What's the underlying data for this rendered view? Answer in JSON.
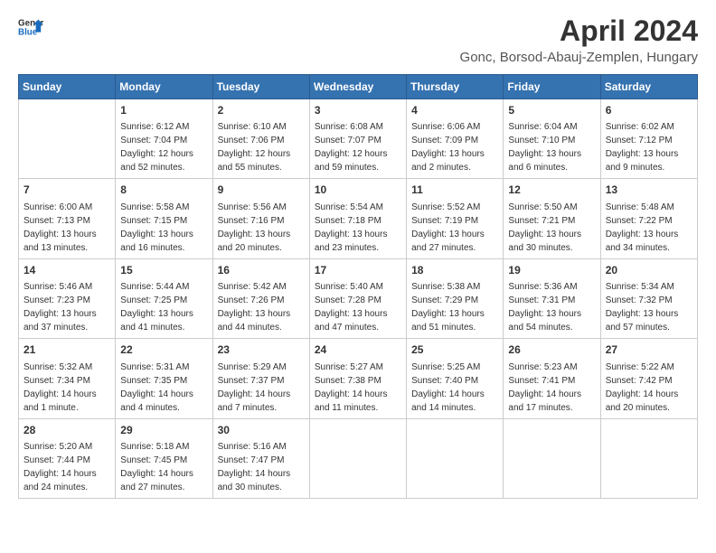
{
  "header": {
    "logo_general": "General",
    "logo_blue": "Blue",
    "month": "April 2024",
    "location": "Gonc, Borsod-Abauj-Zemplen, Hungary"
  },
  "weekdays": [
    "Sunday",
    "Monday",
    "Tuesday",
    "Wednesday",
    "Thursday",
    "Friday",
    "Saturday"
  ],
  "weeks": [
    [
      {
        "day": "",
        "info": ""
      },
      {
        "day": "1",
        "info": "Sunrise: 6:12 AM\nSunset: 7:04 PM\nDaylight: 12 hours\nand 52 minutes."
      },
      {
        "day": "2",
        "info": "Sunrise: 6:10 AM\nSunset: 7:06 PM\nDaylight: 12 hours\nand 55 minutes."
      },
      {
        "day": "3",
        "info": "Sunrise: 6:08 AM\nSunset: 7:07 PM\nDaylight: 12 hours\nand 59 minutes."
      },
      {
        "day": "4",
        "info": "Sunrise: 6:06 AM\nSunset: 7:09 PM\nDaylight: 13 hours\nand 2 minutes."
      },
      {
        "day": "5",
        "info": "Sunrise: 6:04 AM\nSunset: 7:10 PM\nDaylight: 13 hours\nand 6 minutes."
      },
      {
        "day": "6",
        "info": "Sunrise: 6:02 AM\nSunset: 7:12 PM\nDaylight: 13 hours\nand 9 minutes."
      }
    ],
    [
      {
        "day": "7",
        "info": "Sunrise: 6:00 AM\nSunset: 7:13 PM\nDaylight: 13 hours\nand 13 minutes."
      },
      {
        "day": "8",
        "info": "Sunrise: 5:58 AM\nSunset: 7:15 PM\nDaylight: 13 hours\nand 16 minutes."
      },
      {
        "day": "9",
        "info": "Sunrise: 5:56 AM\nSunset: 7:16 PM\nDaylight: 13 hours\nand 20 minutes."
      },
      {
        "day": "10",
        "info": "Sunrise: 5:54 AM\nSunset: 7:18 PM\nDaylight: 13 hours\nand 23 minutes."
      },
      {
        "day": "11",
        "info": "Sunrise: 5:52 AM\nSunset: 7:19 PM\nDaylight: 13 hours\nand 27 minutes."
      },
      {
        "day": "12",
        "info": "Sunrise: 5:50 AM\nSunset: 7:21 PM\nDaylight: 13 hours\nand 30 minutes."
      },
      {
        "day": "13",
        "info": "Sunrise: 5:48 AM\nSunset: 7:22 PM\nDaylight: 13 hours\nand 34 minutes."
      }
    ],
    [
      {
        "day": "14",
        "info": "Sunrise: 5:46 AM\nSunset: 7:23 PM\nDaylight: 13 hours\nand 37 minutes."
      },
      {
        "day": "15",
        "info": "Sunrise: 5:44 AM\nSunset: 7:25 PM\nDaylight: 13 hours\nand 41 minutes."
      },
      {
        "day": "16",
        "info": "Sunrise: 5:42 AM\nSunset: 7:26 PM\nDaylight: 13 hours\nand 44 minutes."
      },
      {
        "day": "17",
        "info": "Sunrise: 5:40 AM\nSunset: 7:28 PM\nDaylight: 13 hours\nand 47 minutes."
      },
      {
        "day": "18",
        "info": "Sunrise: 5:38 AM\nSunset: 7:29 PM\nDaylight: 13 hours\nand 51 minutes."
      },
      {
        "day": "19",
        "info": "Sunrise: 5:36 AM\nSunset: 7:31 PM\nDaylight: 13 hours\nand 54 minutes."
      },
      {
        "day": "20",
        "info": "Sunrise: 5:34 AM\nSunset: 7:32 PM\nDaylight: 13 hours\nand 57 minutes."
      }
    ],
    [
      {
        "day": "21",
        "info": "Sunrise: 5:32 AM\nSunset: 7:34 PM\nDaylight: 14 hours\nand 1 minute."
      },
      {
        "day": "22",
        "info": "Sunrise: 5:31 AM\nSunset: 7:35 PM\nDaylight: 14 hours\nand 4 minutes."
      },
      {
        "day": "23",
        "info": "Sunrise: 5:29 AM\nSunset: 7:37 PM\nDaylight: 14 hours\nand 7 minutes."
      },
      {
        "day": "24",
        "info": "Sunrise: 5:27 AM\nSunset: 7:38 PM\nDaylight: 14 hours\nand 11 minutes."
      },
      {
        "day": "25",
        "info": "Sunrise: 5:25 AM\nSunset: 7:40 PM\nDaylight: 14 hours\nand 14 minutes."
      },
      {
        "day": "26",
        "info": "Sunrise: 5:23 AM\nSunset: 7:41 PM\nDaylight: 14 hours\nand 17 minutes."
      },
      {
        "day": "27",
        "info": "Sunrise: 5:22 AM\nSunset: 7:42 PM\nDaylight: 14 hours\nand 20 minutes."
      }
    ],
    [
      {
        "day": "28",
        "info": "Sunrise: 5:20 AM\nSunset: 7:44 PM\nDaylight: 14 hours\nand 24 minutes."
      },
      {
        "day": "29",
        "info": "Sunrise: 5:18 AM\nSunset: 7:45 PM\nDaylight: 14 hours\nand 27 minutes."
      },
      {
        "day": "30",
        "info": "Sunrise: 5:16 AM\nSunset: 7:47 PM\nDaylight: 14 hours\nand 30 minutes."
      },
      {
        "day": "",
        "info": ""
      },
      {
        "day": "",
        "info": ""
      },
      {
        "day": "",
        "info": ""
      },
      {
        "day": "",
        "info": ""
      }
    ]
  ]
}
